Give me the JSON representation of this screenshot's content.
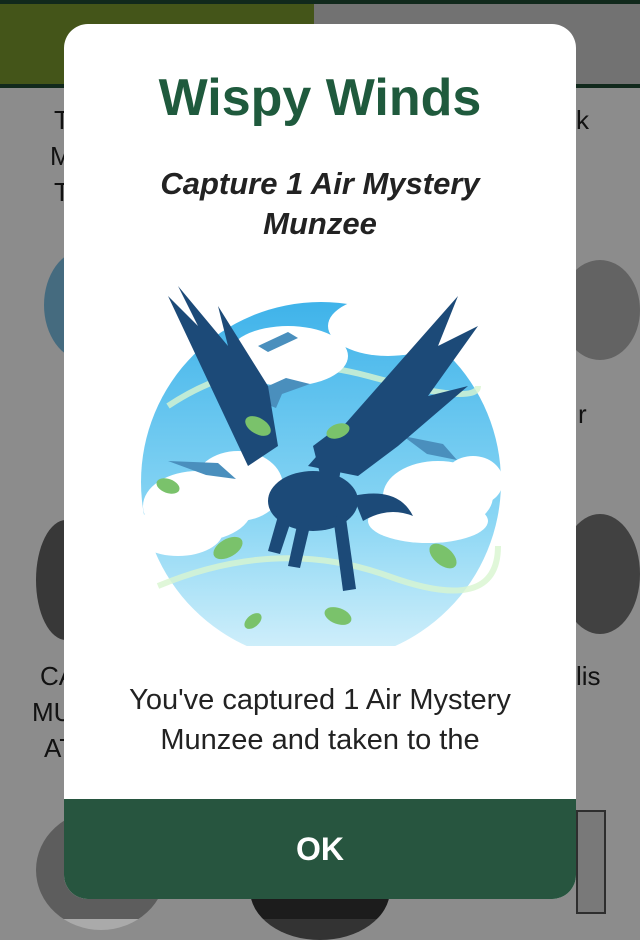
{
  "background": {
    "tabs": [
      "",
      ""
    ],
    "fragments": {
      "top_left_1": "T",
      "top_left_2": "M",
      "top_left_3": "T",
      "top_right": "k",
      "mid_right": "r",
      "low_left_1": "CA",
      "low_left_2": "MU",
      "low_left_3": "AT",
      "low_right": "lis"
    }
  },
  "modal": {
    "title": "Wispy Winds",
    "subtitle": "Capture 1 Air Mystery Munzee",
    "badge_icon": "pegasus-air-badge",
    "body": "You've captured 1 Air Mystery Munzee and taken to the",
    "ok_label": "OK"
  },
  "colors": {
    "title_green": "#1f5a3d",
    "button_green": "#27553f",
    "tab_active": "#7d9b2e",
    "pegasus": "#1c4a78",
    "sky": "#5cc3ec"
  }
}
